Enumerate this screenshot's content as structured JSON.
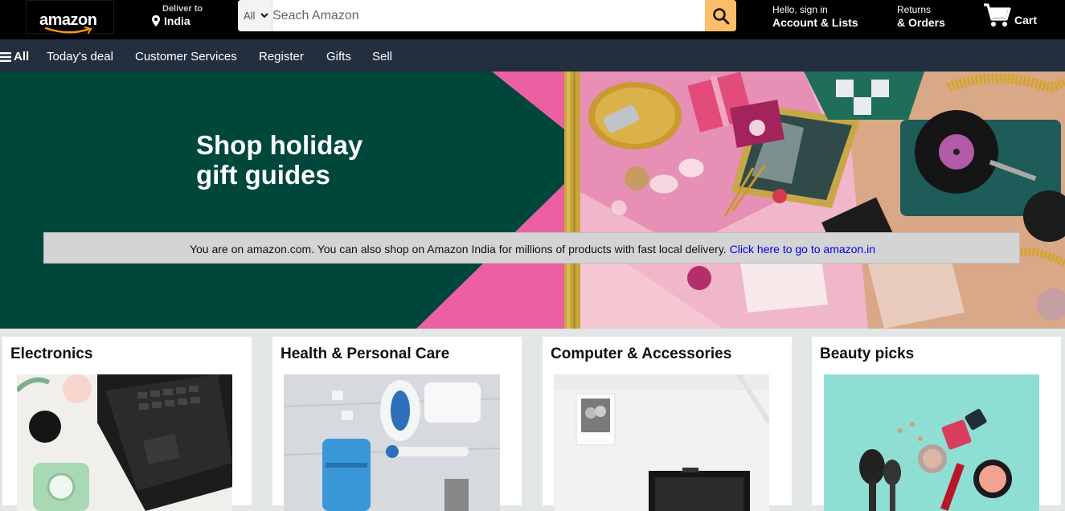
{
  "header": {
    "logo_text": "amazon",
    "deliver_line1": "Deliver to",
    "deliver_line2": "India",
    "search_category": "All",
    "search_placeholder": "Seach Amazon",
    "account_line1": "Hello, sign in",
    "account_line2": "Account & Lists",
    "returns_line1": "Returns",
    "returns_line2": "& Orders",
    "cart_label": "Cart",
    "icons": [
      "location-pin-icon",
      "chevron-down-icon",
      "search-icon",
      "cart-icon"
    ]
  },
  "subnav": {
    "all_label": "All",
    "items": [
      "Today's deal",
      "Customer Services",
      "Register",
      "Gifts",
      "Sell"
    ]
  },
  "hero": {
    "title_line1": "Shop holiday",
    "title_line2": "gift guides"
  },
  "notice": {
    "text": "You are on amazon.com. You can also shop on Amazon India for millions of products with fast local delivery.",
    "link_text": "Click here to go to amazon.in"
  },
  "cards": [
    {
      "title": "Electronics"
    },
    {
      "title": "Health & Personal Care"
    },
    {
      "title": "Computer & Accessories"
    },
    {
      "title": "Beauty picks"
    }
  ],
  "colors": {
    "nav_top_bg": "#000000",
    "nav_sub_bg": "#232f3e",
    "search_button": "#febd69",
    "hero_green": "#00473b",
    "hero_pink": "#ec5fa3",
    "link": "#0000ee",
    "page_bg": "#e3e6e6"
  }
}
